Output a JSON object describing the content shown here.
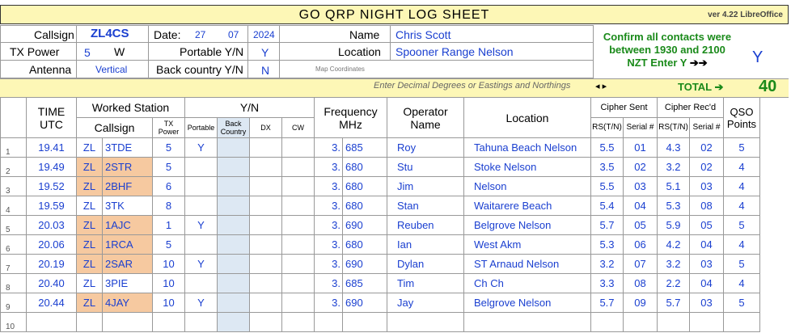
{
  "title": "GO  QRP  NIGHT  LOG  SHEET",
  "version": "ver 4.22 LibreOffice",
  "header": {
    "callsign_label": "Callsign",
    "callsign": "ZL4CS",
    "date_label": "Date:",
    "date_day": "27",
    "date_month": "07",
    "date_year": "2024",
    "name_label": "Name",
    "name": "Chris Scott",
    "tx_power_label": "TX Power",
    "tx_power": "5",
    "tx_power_unit": "W",
    "portable_label": "Portable Y/N",
    "portable": "Y",
    "location_label": "Location",
    "location": "Spooner Range Nelson",
    "antenna_label": "Antenna",
    "antenna": "Vertical",
    "backcountry_label": "Back country Y/N",
    "backcountry": "N",
    "map_coords_label": "Map Coordinates"
  },
  "confirm": {
    "line1": "Confirm all contacts were",
    "line2": "between 1930 and 2100",
    "line3": "NZT     Enter  Y",
    "arrows": "➔➔",
    "answer": "Y"
  },
  "hint": "Enter  Decimal Degrees or Eastings and Northings",
  "hint_arrows": "◂                          ▸",
  "total_label": "TOTAL ➔",
  "total": "40",
  "columns": {
    "time": "TIME UTC",
    "worked_station": "Worked Station",
    "yn": "Y/N",
    "frequency": "Frequency MHz",
    "operator": "Operator Name",
    "location": "Location",
    "cipher_sent": "Cipher Sent",
    "cipher_recd": "Cipher Rec'd",
    "qso_points": "QSO Points",
    "callsign": "Callsign",
    "tx_power": "TX Power",
    "portable": "Portable",
    "back_country": "Back Country",
    "dx": "DX",
    "cw": "CW",
    "rs_sent": "RS(T/N)",
    "serial_sent": "Serial #",
    "rs_recd": "RS(T/N)",
    "serial_recd": "Serial #"
  },
  "rows": [
    {
      "n": "1",
      "time": "19.41",
      "pre": "ZL",
      "call": "3TDE",
      "pwr": "5",
      "port": "Y",
      "mhz_a": "3.",
      "mhz_b": "685",
      "op": "Roy",
      "loc": "Tahuna Beach Nelson",
      "rs_s": "5.5",
      "ser_s": "01",
      "rs_r": "4.3",
      "ser_r": "02",
      "pts": "5",
      "orange": false
    },
    {
      "n": "2",
      "time": "19.49",
      "pre": "ZL",
      "call": "2STR",
      "pwr": "5",
      "port": "",
      "mhz_a": "3.",
      "mhz_b": "680",
      "op": "Stu",
      "loc": "Stoke Nelson",
      "rs_s": "3.5",
      "ser_s": "02",
      "rs_r": "3.2",
      "ser_r": "02",
      "pts": "4",
      "orange": true
    },
    {
      "n": "3",
      "time": "19.52",
      "pre": "ZL",
      "call": "2BHF",
      "pwr": "6",
      "port": "",
      "mhz_a": "3.",
      "mhz_b": "680",
      "op": "Jim",
      "loc": "Nelson",
      "rs_s": "5.5",
      "ser_s": "03",
      "rs_r": "5.1",
      "ser_r": "03",
      "pts": "4",
      "orange": true
    },
    {
      "n": "4",
      "time": "19.59",
      "pre": "ZL",
      "call": "3TK",
      "pwr": "8",
      "port": "",
      "mhz_a": "3.",
      "mhz_b": "680",
      "op": "Stan",
      "loc": "Waitarere Beach",
      "rs_s": "5.4",
      "ser_s": "04",
      "rs_r": "5.3",
      "ser_r": "08",
      "pts": "4",
      "orange": false
    },
    {
      "n": "5",
      "time": "20.03",
      "pre": "ZL",
      "call": "1AJC",
      "pwr": "1",
      "port": "Y",
      "mhz_a": "3.",
      "mhz_b": "690",
      "op": "Reuben",
      "loc": "Belgrove Nelson",
      "rs_s": "5.7",
      "ser_s": "05",
      "rs_r": "5.9",
      "ser_r": "05",
      "pts": "5",
      "orange": true
    },
    {
      "n": "6",
      "time": "20.06",
      "pre": "ZL",
      "call": "1RCA",
      "pwr": "5",
      "port": "",
      "mhz_a": "3.",
      "mhz_b": "680",
      "op": "Ian",
      "loc": "West Akm",
      "rs_s": "5.3",
      "ser_s": "06",
      "rs_r": "4.2",
      "ser_r": "04",
      "pts": "4",
      "orange": true
    },
    {
      "n": "7",
      "time": "20.19",
      "pre": "ZL",
      "call": "2SAR",
      "pwr": "10",
      "port": "Y",
      "mhz_a": "3.",
      "mhz_b": "690",
      "op": "Dylan",
      "loc": "ST Arnaud Nelson",
      "rs_s": "3.2",
      "ser_s": "07",
      "rs_r": "3.2",
      "ser_r": "03",
      "pts": "5",
      "orange": true
    },
    {
      "n": "8",
      "time": "20.40",
      "pre": "ZL",
      "call": "3PIE",
      "pwr": "10",
      "port": "",
      "mhz_a": "3.",
      "mhz_b": "685",
      "op": "Tim",
      "loc": "Ch Ch",
      "rs_s": "3.3",
      "ser_s": "08",
      "rs_r": "2.2",
      "ser_r": "04",
      "pts": "4",
      "orange": false
    },
    {
      "n": "9",
      "time": "20.44",
      "pre": "ZL",
      "call": "4JAY",
      "pwr": "10",
      "port": "Y",
      "mhz_a": "3.",
      "mhz_b": "690",
      "op": "Jay",
      "loc": "Belgrove Nelson",
      "rs_s": "5.7",
      "ser_s": "09",
      "rs_r": "5.7",
      "ser_r": "03",
      "pts": "5",
      "orange": true
    },
    {
      "n": "10",
      "time": "",
      "pre": "",
      "call": "",
      "pwr": "",
      "port": "",
      "mhz_a": "",
      "mhz_b": "",
      "op": "",
      "loc": "",
      "rs_s": "",
      "ser_s": "",
      "rs_r": "",
      "ser_r": "",
      "pts": "",
      "orange": false
    }
  ],
  "colors": {
    "title_bg": "#fdf7b6",
    "value_blue": "#1a3fd0",
    "confirm_green": "#1a8a1a",
    "orange_cell": "#f6c9a0",
    "backcountry_shade": "#dde8f3"
  }
}
